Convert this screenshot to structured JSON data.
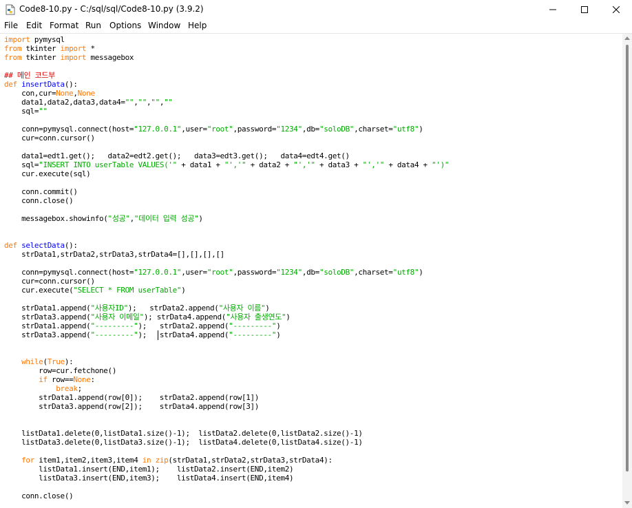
{
  "window": {
    "title": "Code8-10.py - C:/sql/sql/Code8-10.py (3.9.2)",
    "minimize_glyph": "—",
    "maximize_glyph": "☐",
    "close_glyph": "✕"
  },
  "menu": [
    "File",
    "Edit",
    "Format",
    "Run",
    "Options",
    "Window",
    "Help"
  ],
  "colors": {
    "keyword": "#ff7700",
    "definition": "#0000ff",
    "string": "#00aa00",
    "comment": "#dd0000",
    "text": "#000000"
  },
  "code": [
    [
      [
        "kw",
        "import"
      ],
      [
        "n",
        " pymysql"
      ]
    ],
    [
      [
        "kw",
        "from"
      ],
      [
        "n",
        " tkinter "
      ],
      [
        "kw",
        "import"
      ],
      [
        "n",
        " *"
      ]
    ],
    [
      [
        "kw",
        "from"
      ],
      [
        "n",
        " tkinter "
      ],
      [
        "kw",
        "import"
      ],
      [
        "n",
        " messagebox"
      ]
    ],
    [],
    [
      [
        "com",
        "## 메인 코드부"
      ]
    ],
    [
      [
        "kw",
        "def"
      ],
      [
        "n",
        " "
      ],
      [
        "def",
        "insertData"
      ],
      [
        "n",
        "():"
      ]
    ],
    [
      [
        "n",
        "    con,cur="
      ],
      [
        "kw",
        "None"
      ],
      [
        "n",
        ","
      ],
      [
        "kw",
        "None"
      ]
    ],
    [
      [
        "n",
        "    data1,data2,data3,data4="
      ],
      [
        "str",
        "\"\""
      ],
      [
        "n",
        ","
      ],
      [
        "str",
        "\"\""
      ],
      [
        "n",
        ","
      ],
      [
        "str",
        "\"\""
      ],
      [
        "n",
        ","
      ],
      [
        "str",
        "\"\""
      ]
    ],
    [
      [
        "n",
        "    sql="
      ],
      [
        "str",
        "\"\""
      ]
    ],
    [],
    [
      [
        "n",
        "    conn=pymysql.connect(host="
      ],
      [
        "str",
        "\"127.0.0.1\""
      ],
      [
        "n",
        ",user="
      ],
      [
        "str",
        "\"root\""
      ],
      [
        "n",
        ",password="
      ],
      [
        "str",
        "\"1234\""
      ],
      [
        "n",
        ",db="
      ],
      [
        "str",
        "\"soloDB\""
      ],
      [
        "n",
        ",charset="
      ],
      [
        "str",
        "\"utf8\""
      ],
      [
        "n",
        ")"
      ]
    ],
    [
      [
        "n",
        "    cur=conn.cursor()"
      ]
    ],
    [],
    [
      [
        "n",
        "    data1=edt1.get();   data2=edt2.get();   data3=edt3.get();   data4=edt4.get()"
      ]
    ],
    [
      [
        "n",
        "    sql="
      ],
      [
        "str",
        "\"INSERT INTO userTable VALUES('\""
      ],
      [
        "n",
        " + data1 + "
      ],
      [
        "str",
        "\"','\""
      ],
      [
        "n",
        " + data2 + "
      ],
      [
        "str",
        "\"','\""
      ],
      [
        "n",
        " + data3 + "
      ],
      [
        "str",
        "\"','\""
      ],
      [
        "n",
        " + data4 + "
      ],
      [
        "str",
        "\"')\""
      ]
    ],
    [
      [
        "n",
        "    cur.execute(sql)"
      ]
    ],
    [],
    [
      [
        "n",
        "    conn.commit()"
      ]
    ],
    [
      [
        "n",
        "    conn.close()"
      ]
    ],
    [],
    [
      [
        "n",
        "    messagebox.showinfo("
      ],
      [
        "str",
        "\"성공\""
      ],
      [
        "n",
        ","
      ],
      [
        "str",
        "\"데이터 입력 성공\""
      ],
      [
        "n",
        ")"
      ]
    ],
    [],
    [],
    [
      [
        "kw",
        "def"
      ],
      [
        "n",
        " "
      ],
      [
        "def",
        "selectData"
      ],
      [
        "n",
        "():"
      ]
    ],
    [
      [
        "n",
        "    strData1,strData2,strData3,strData4=[],[],[],[]"
      ]
    ],
    [],
    [
      [
        "n",
        "    conn=pymysql.connect(host="
      ],
      [
        "str",
        "\"127.0.0.1\""
      ],
      [
        "n",
        ",user="
      ],
      [
        "str",
        "\"root\""
      ],
      [
        "n",
        ",password="
      ],
      [
        "str",
        "\"1234\""
      ],
      [
        "n",
        ",db="
      ],
      [
        "str",
        "\"soloDB\""
      ],
      [
        "n",
        ",charset="
      ],
      [
        "str",
        "\"utf8\""
      ],
      [
        "n",
        ")"
      ]
    ],
    [
      [
        "n",
        "    cur=conn.cursor()"
      ]
    ],
    [
      [
        "n",
        "    cur.execute("
      ],
      [
        "str",
        "\"SELECT * FROM userTable\""
      ],
      [
        "n",
        ")"
      ]
    ],
    [],
    [
      [
        "n",
        "    strData1.append("
      ],
      [
        "str",
        "\"사용자ID\""
      ],
      [
        "n",
        ");   strData2.append("
      ],
      [
        "str",
        "\"사용자 이름\""
      ],
      [
        "n",
        ")"
      ]
    ],
    [
      [
        "n",
        "    strData3.append("
      ],
      [
        "str",
        "\"사용자 이메일\""
      ],
      [
        "n",
        "); strData4.append("
      ],
      [
        "str",
        "\"사용자 출생연도\""
      ],
      [
        "n",
        ")"
      ]
    ],
    [
      [
        "n",
        "    strData1.append("
      ],
      [
        "str",
        "\"---------\""
      ],
      [
        "n",
        ");   strData2.append("
      ],
      [
        "str",
        "\"---------\""
      ],
      [
        "n",
        ")"
      ]
    ],
    [
      [
        "n",
        "    strData3.append("
      ],
      [
        "str",
        "\"---------\""
      ],
      [
        "n",
        ");   strData4.append("
      ],
      [
        "str",
        "\"---------\""
      ],
      [
        "n",
        ")"
      ]
    ],
    [],
    [],
    [
      [
        "n",
        "    "
      ],
      [
        "kw",
        "while"
      ],
      [
        "n",
        "("
      ],
      [
        "kw",
        "True"
      ],
      [
        "n",
        "):"
      ]
    ],
    [
      [
        "n",
        "        row=cur.fetchone()"
      ]
    ],
    [
      [
        "n",
        "        "
      ],
      [
        "kw",
        "if"
      ],
      [
        "n",
        " row=="
      ],
      [
        "kw",
        "None"
      ],
      [
        "n",
        ":"
      ]
    ],
    [
      [
        "n",
        "            "
      ],
      [
        "kw",
        "break"
      ],
      [
        "n",
        ";"
      ]
    ],
    [
      [
        "n",
        "        strData1.append(row[0]);    strData2.append(row[1])"
      ]
    ],
    [
      [
        "n",
        "        strData3.append(row[2]);    strData4.append(row[3])"
      ]
    ],
    [],
    [],
    [
      [
        "n",
        "    listData1.delete(0,listData1.size()-1);  listData2.delete(0,listData2.size()-1)"
      ]
    ],
    [
      [
        "n",
        "    listData3.delete(0,listData3.size()-1);  listData4.delete(0,listData4.size()-1)"
      ]
    ],
    [],
    [
      [
        "n",
        "    "
      ],
      [
        "kw",
        "for"
      ],
      [
        "n",
        " item1,item2,item3,item4 "
      ],
      [
        "kw",
        "in"
      ],
      [
        "n",
        " "
      ],
      [
        "kw",
        "zip"
      ],
      [
        "n",
        "(strData1,strData2,strData3,strData4):"
      ]
    ],
    [
      [
        "n",
        "        listData1.insert(END,item1);    listData2.insert(END,item2)"
      ]
    ],
    [
      [
        "n",
        "        listData3.insert(END,item3);    listData4.insert(END,item4)"
      ]
    ],
    [],
    [
      [
        "n",
        "    conn.close()"
      ]
    ]
  ]
}
